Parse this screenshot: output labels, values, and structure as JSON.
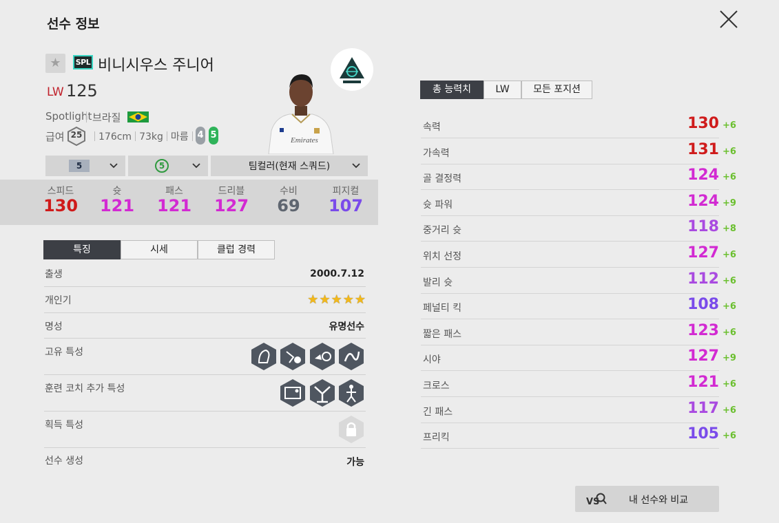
{
  "header": {
    "title": "선수 정보"
  },
  "player": {
    "season_code": "SPL",
    "name": "비니시우스 주니어",
    "position": "LW",
    "ovr": "125",
    "season_name": "Spotlight",
    "nation": "브라질",
    "salary_label": "급여",
    "salary": "25",
    "height": "176cm",
    "weight": "73kg",
    "body_type": "마름",
    "weak_foot_left": "4",
    "weak_foot_right": "5",
    "photo_caption": "Emirates"
  },
  "dropdowns": {
    "grade": "5",
    "enhance": "5",
    "team_color": "팀컬러(현재 스쿼드)"
  },
  "summary_stats": [
    {
      "label": "스피드",
      "value": "130",
      "color": "#cf1b1b"
    },
    {
      "label": "슛",
      "value": "121",
      "color": "#d22ad2"
    },
    {
      "label": "패스",
      "value": "121",
      "color": "#d22ad2"
    },
    {
      "label": "드리블",
      "value": "127",
      "color": "#d22ad2"
    },
    {
      "label": "수비",
      "value": "69",
      "color": "#5f6670"
    },
    {
      "label": "피지컬",
      "value": "107",
      "color": "#7a4bea"
    }
  ],
  "left_tabs": [
    "특징",
    "시세",
    "클럽 경력"
  ],
  "info": {
    "birth_label": "출생",
    "birth_value": "2000.7.12",
    "popularity_label": "개인기",
    "popularity_stars": 5,
    "reputation_label": "명성",
    "reputation_value": "유명선수",
    "unique_traits_label": "고유 특성",
    "coach_traits_label": "훈련 코치 추가 특성",
    "acquired_traits_label": "획득 특성",
    "creation_label": "선수 생성",
    "creation_value": "가능"
  },
  "right_tabs": [
    "총 능력치",
    "LW",
    "모든 포지션"
  ],
  "attributes": [
    {
      "label": "속력",
      "value": "130",
      "bonus": "+6",
      "color": "#cf1b1b"
    },
    {
      "label": "가속력",
      "value": "131",
      "bonus": "+6",
      "color": "#cf1b1b"
    },
    {
      "label": "골 결정력",
      "value": "124",
      "bonus": "+6",
      "color": "#d22ad2"
    },
    {
      "label": "슛 파워",
      "value": "124",
      "bonus": "+9",
      "color": "#d22ad2"
    },
    {
      "label": "중거리 슛",
      "value": "118",
      "bonus": "+8",
      "color": "#a94ae0"
    },
    {
      "label": "위치 선정",
      "value": "127",
      "bonus": "+6",
      "color": "#d22ad2"
    },
    {
      "label": "발리 슛",
      "value": "112",
      "bonus": "+6",
      "color": "#a94ae0"
    },
    {
      "label": "페널티 킥",
      "value": "108",
      "bonus": "+6",
      "color": "#7a4bea"
    },
    {
      "label": "짧은 패스",
      "value": "123",
      "bonus": "+6",
      "color": "#d22ad2"
    },
    {
      "label": "시야",
      "value": "127",
      "bonus": "+9",
      "color": "#d22ad2"
    },
    {
      "label": "크로스",
      "value": "121",
      "bonus": "+6",
      "color": "#d22ad2"
    },
    {
      "label": "긴 패스",
      "value": "117",
      "bonus": "+6",
      "color": "#a94ae0"
    },
    {
      "label": "프리킥",
      "value": "105",
      "bonus": "+6",
      "color": "#7a4bea"
    }
  ],
  "compare_button": "내 선수와 비교",
  "icons": {
    "close": "close-icon",
    "favorite": "star-icon",
    "season_logo": "spotlight-logo",
    "chevron": "chevron-down-icon",
    "vs": "vs-search-icon",
    "lock": "lock-icon"
  },
  "colors": {
    "ovr_position": "#c0212b",
    "bonus": "#6abf2e",
    "tab_active": "#3c3f45"
  }
}
